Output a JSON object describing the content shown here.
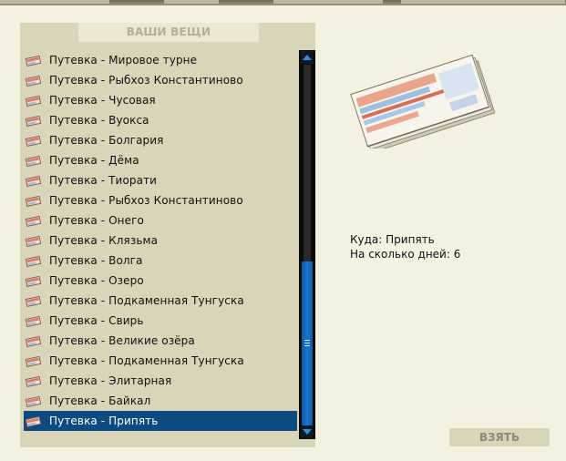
{
  "panel": {
    "title": "ВАШИ ВЕЩИ"
  },
  "items": [
    {
      "label": "Путевка - Мировое турне"
    },
    {
      "label": "Путевка - Рыбхоз Константиново"
    },
    {
      "label": "Путевка - Чусовая"
    },
    {
      "label": "Путевка - Вуокса"
    },
    {
      "label": "Путевка - Болгария"
    },
    {
      "label": "Путевка - Дёма"
    },
    {
      "label": "Путевка - Тиорати"
    },
    {
      "label": "Путевка - Рыбхоз Константиново"
    },
    {
      "label": "Путевка - Онего"
    },
    {
      "label": "Путевка - Клязьма"
    },
    {
      "label": "Путевка - Волга"
    },
    {
      "label": "Путевка - Озеро"
    },
    {
      "label": "Путевка - Подкаменная Тунгуска"
    },
    {
      "label": "Путевка - Свирь"
    },
    {
      "label": "Путевка - Великие озёра"
    },
    {
      "label": "Путевка - Подкаменная Тунгуска"
    },
    {
      "label": "Путевка - Элитарная"
    },
    {
      "label": "Путевка - Байкал"
    },
    {
      "label": "Путевка - Припять",
      "selected": true
    }
  ],
  "details": {
    "destination_label": "Куда:",
    "destination_value": "Припять",
    "days_label": "На сколько дней:",
    "days_value": "6"
  },
  "actions": {
    "take_label": "ВЗЯТЬ"
  },
  "icons": {
    "item_icon": "ticket-icon",
    "preview": "ticket-booklet-image"
  },
  "colors": {
    "selection": "#0c4a82",
    "scroll_thumb": "#1b74cf",
    "panel": "#d8d5b8",
    "background": "#f3f1df"
  }
}
